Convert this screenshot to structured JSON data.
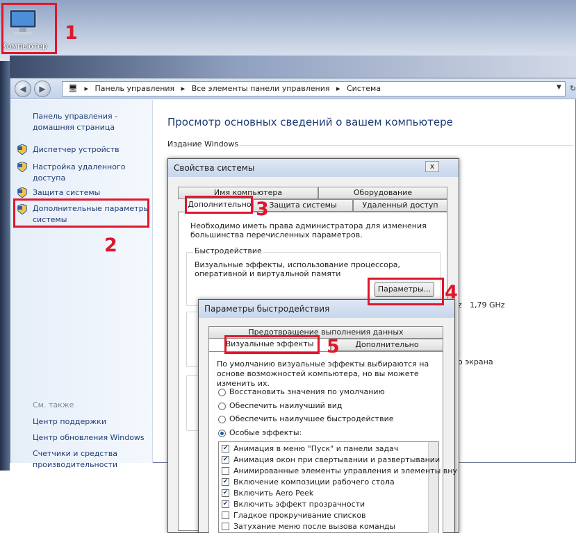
{
  "desktop": {
    "computer_label": "Компьютер"
  },
  "annotations": [
    "1",
    "2",
    "3",
    "4",
    "5"
  ],
  "address_bar": {
    "crumbs": [
      "Панель управления",
      "Все элементы панели управления",
      "Система"
    ]
  },
  "left_pane": {
    "home": "Панель управления - домашняя страница",
    "links": [
      "Диспетчер устройств",
      "Настройка удаленного доступа",
      "Защита системы",
      "Дополнительные параметры системы"
    ],
    "see_also": "См. также",
    "see_links": [
      "Центр поддержки",
      "Центр обновления Windows",
      "Счетчики и средства производительности"
    ]
  },
  "main": {
    "title": "Просмотр основных сведений о вашем компьютере",
    "edition": "Издание Windows",
    "cpu_speed": "1,79 GHz",
    "screen_text": "о экрана",
    "z": "z"
  },
  "sysprops": {
    "title": "Свойства системы",
    "tabs_top": [
      "Имя компьютера",
      "Оборудование"
    ],
    "tabs_bottom": [
      "Дополнительно",
      "Защита системы",
      "Удаленный доступ"
    ],
    "admin_note": "Необходимо иметь права администратора для изменения большинства перечисленных параметров.",
    "perf_group": "Быстродействие",
    "perf_desc": "Визуальные эффекты, использование процессора, оперативной и виртуальной памяти",
    "params_btn": "Параметры...",
    "close": "x"
  },
  "perf": {
    "title": "Параметры быстродействия",
    "tab_dep": "Предотвращение выполнения данных",
    "tab_visual": "Визуальные эффекты",
    "tab_adv": "Дополнительно",
    "note": "По умолчанию визуальные эффекты выбираются на основе возможностей компьютера, но вы можете изменить их.",
    "radios": [
      "Восстановить значения по умолчанию",
      "Обеспечить наилучший вид",
      "Обеспечить наилучшее быстродействие",
      "Особые эффекты:"
    ],
    "effects": [
      {
        "label": "Анимация в меню \"Пуск\" и панели задач",
        "checked": true
      },
      {
        "label": "Анимация окон при свертывании и развертывании",
        "checked": true
      },
      {
        "label": "Анимированные элементы управления и элементы вну",
        "checked": false
      },
      {
        "label": "Включение композиции рабочего стола",
        "checked": true
      },
      {
        "label": "Включить Aero Peek",
        "checked": true
      },
      {
        "label": "Включить эффект прозрачности",
        "checked": true
      },
      {
        "label": "Гладкое прокручивание списков",
        "checked": false
      },
      {
        "label": "Затухание меню после вызова команды",
        "checked": false
      }
    ]
  }
}
